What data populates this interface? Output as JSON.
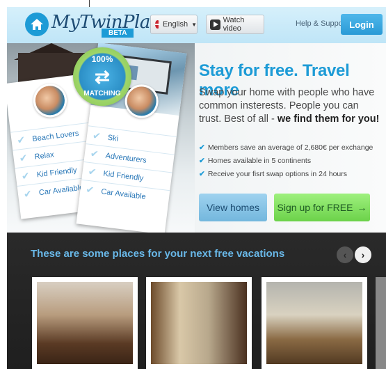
{
  "header": {
    "logo_text": "MyTwinPlace",
    "beta_label": "BETA",
    "language_label": "English",
    "watch_video_label": "Watch video",
    "help_label": "Help & Support",
    "login_label": "Login"
  },
  "hero": {
    "badge_percent": "100%",
    "badge_word": "MATCHING",
    "left_card_items": [
      "Beach Lovers",
      "Relax",
      "Kid Friendly",
      "Car Available"
    ],
    "right_card_items": [
      "Ski",
      "Adventurers",
      "Kid Friendly",
      "Car Available"
    ],
    "title": "Stay for free. Travel more",
    "description": "Swap your home with people who have common insterests. People you can trust. Best of all - ",
    "description_bold": "we find them for you!",
    "bullets": [
      "Members save an average of 2,680€ per exchange",
      "Homes available in 5 continents",
      "Receive your fisrt swap options in 24 hours"
    ],
    "view_homes_label": "View homes",
    "signup_label": "Sign up for FREE"
  },
  "places": {
    "title": "These are some places for your next free vacations"
  },
  "colors": {
    "brand_blue": "#1d9bd6",
    "signup_green": "#6cd24a",
    "dark_bg": "#262626"
  }
}
